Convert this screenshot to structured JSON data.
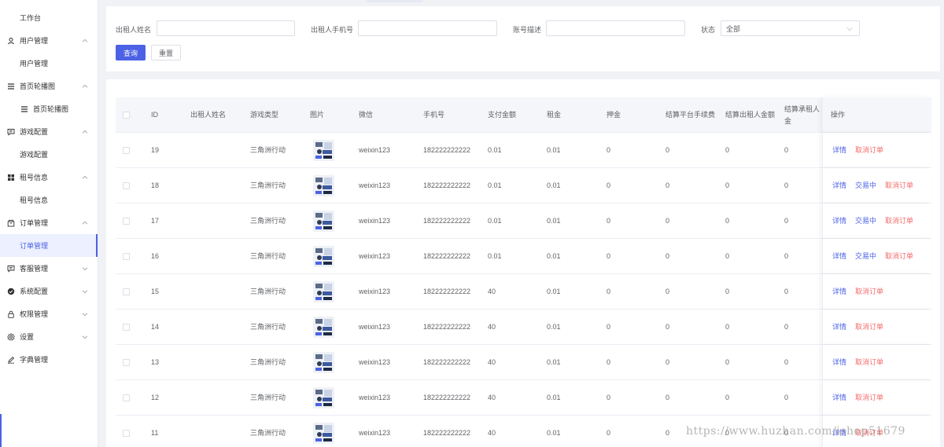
{
  "sidebar": {
    "items": [
      {
        "label": "工作台",
        "level": 2,
        "icon": "",
        "expandable": false
      },
      {
        "label": "用户管理",
        "level": 1,
        "icon": "user-icon",
        "expandable": true
      },
      {
        "label": "用户管理",
        "level": 2,
        "icon": "",
        "expandable": false
      },
      {
        "label": "首页轮播图",
        "level": 1,
        "icon": "menu-lines-icon",
        "expandable": true
      },
      {
        "label": "首页轮播图",
        "level": 3,
        "icon": "menu-lines-icon",
        "expandable": false
      },
      {
        "label": "游戏配置",
        "level": 1,
        "icon": "chat-icon",
        "expandable": true
      },
      {
        "label": "游戏配置",
        "level": 2,
        "icon": "",
        "expandable": false
      },
      {
        "label": "租号信息",
        "level": 1,
        "icon": "grid-icon",
        "expandable": true
      },
      {
        "label": "租号信息",
        "level": 2,
        "icon": "",
        "expandable": false
      },
      {
        "label": "订单管理",
        "level": 1,
        "icon": "package-icon",
        "expandable": true
      },
      {
        "label": "订单管理",
        "level": 2,
        "icon": "",
        "expandable": false,
        "active": true
      },
      {
        "label": "客服管理",
        "level": 1,
        "icon": "chat-icon",
        "expandable": true,
        "collapsed": true
      },
      {
        "label": "系统配置",
        "level": 1,
        "icon": "check-circle-icon",
        "expandable": true,
        "collapsed": true
      },
      {
        "label": "权限管理",
        "level": 1,
        "icon": "lock-icon",
        "expandable": true,
        "collapsed": true
      },
      {
        "label": "设置",
        "level": 1,
        "icon": "gear-icon",
        "expandable": true,
        "collapsed": true
      },
      {
        "label": "字典管理",
        "level": 1,
        "icon": "edit-icon",
        "expandable": false
      }
    ]
  },
  "search": {
    "renter_name_label": "出租人姓名",
    "renter_phone_label": "出租人手机号",
    "account_desc_label": "账号描述",
    "status_label": "状态",
    "status_value": "全部",
    "query_button": "查询",
    "reset_button": "重置"
  },
  "table": {
    "columns": [
      "ID",
      "出租人姓名",
      "游戏类型",
      "图片",
      "微信",
      "手机号",
      "支付金额",
      "租金",
      "押金",
      "结算平台手续费",
      "结算出租人金额",
      "结算承租人金",
      "操作"
    ],
    "rows": [
      {
        "id": "19",
        "name": "",
        "game": "三角洲行动",
        "wechat": "weixin123",
        "phone": "182222222222",
        "pay": "0.01",
        "rent": "0.01",
        "deposit": "0",
        "fee": "0",
        "owner": "0",
        "tenant": "0",
        "actions": [
          "详情",
          "取消订单"
        ]
      },
      {
        "id": "18",
        "name": "",
        "game": "三角洲行动",
        "wechat": "weixin123",
        "phone": "182222222222",
        "pay": "0.01",
        "rent": "0.01",
        "deposit": "0",
        "fee": "0",
        "owner": "0",
        "tenant": "0",
        "actions": [
          "详情",
          "交易中",
          "取消订单"
        ]
      },
      {
        "id": "17",
        "name": "",
        "game": "三角洲行动",
        "wechat": "weixin123",
        "phone": "182222222222",
        "pay": "0.01",
        "rent": "0.01",
        "deposit": "0",
        "fee": "0",
        "owner": "0",
        "tenant": "0",
        "actions": [
          "详情",
          "交易中",
          "取消订单"
        ]
      },
      {
        "id": "16",
        "name": "",
        "game": "三角洲行动",
        "wechat": "weixin123",
        "phone": "182222222222",
        "pay": "0.01",
        "rent": "0.01",
        "deposit": "0",
        "fee": "0",
        "owner": "0",
        "tenant": "0",
        "actions": [
          "详情",
          "交易中",
          "取消订单"
        ]
      },
      {
        "id": "15",
        "name": "",
        "game": "三角洲行动",
        "wechat": "weixin123",
        "phone": "182222222222",
        "pay": "40",
        "rent": "0.01",
        "deposit": "0",
        "fee": "0",
        "owner": "0",
        "tenant": "0",
        "actions": [
          "详情",
          "取消订单"
        ]
      },
      {
        "id": "14",
        "name": "",
        "game": "三角洲行动",
        "wechat": "weixin123",
        "phone": "182222222222",
        "pay": "40",
        "rent": "0.01",
        "deposit": "0",
        "fee": "0",
        "owner": "0",
        "tenant": "0",
        "actions": [
          "详情",
          "取消订单"
        ]
      },
      {
        "id": "13",
        "name": "",
        "game": "三角洲行动",
        "wechat": "weixin123",
        "phone": "182222222222",
        "pay": "40",
        "rent": "0.01",
        "deposit": "0",
        "fee": "0",
        "owner": "0",
        "tenant": "0",
        "actions": [
          "详情",
          "取消订单"
        ]
      },
      {
        "id": "12",
        "name": "",
        "game": "三角洲行动",
        "wechat": "weixin123",
        "phone": "182222222222",
        "pay": "40",
        "rent": "0.01",
        "deposit": "0",
        "fee": "0",
        "owner": "0",
        "tenant": "0",
        "actions": [
          "详情",
          "取消订单"
        ]
      },
      {
        "id": "11",
        "name": "",
        "game": "三角洲行动",
        "wechat": "weixin123",
        "phone": "182222222222",
        "pay": "40",
        "rent": "0.01",
        "deposit": "0",
        "fee": "0",
        "owner": "0",
        "tenant": "0",
        "actions": [
          "详情",
          "取消订单"
        ]
      }
    ]
  },
  "watermark": "https://www.huzhan.com/ishop51679",
  "colors": {
    "accent": "#4b62e5",
    "danger": "#f56c6c",
    "border": "#ebeef5"
  }
}
